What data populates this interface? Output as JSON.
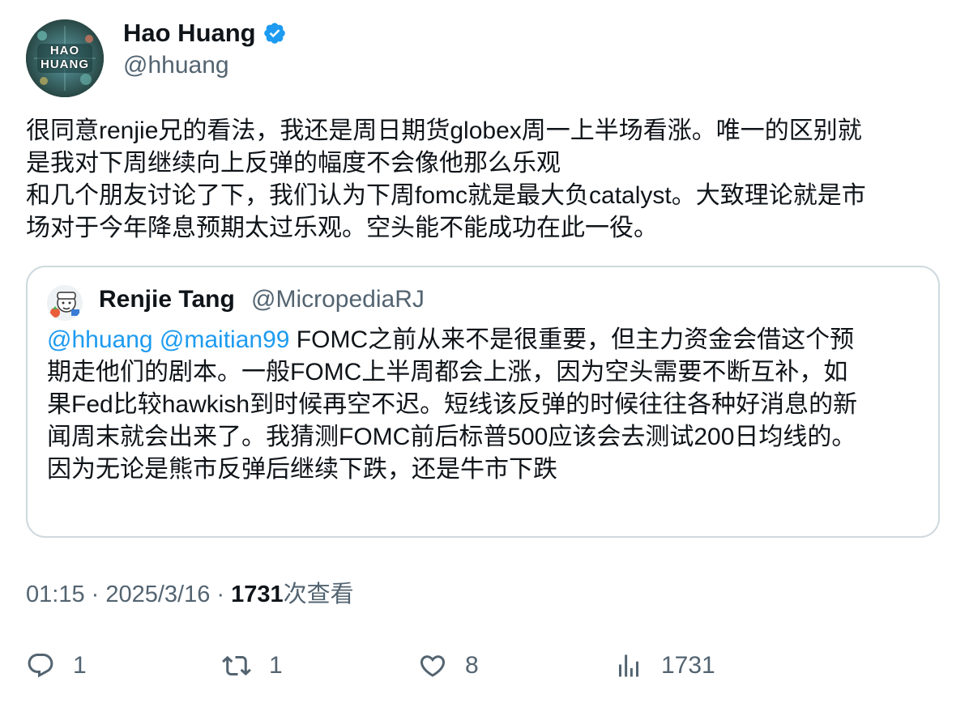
{
  "author": {
    "display_name": "Hao Huang",
    "handle": "@hhuang",
    "avatar_text": "HAO HUANG",
    "verified_color": "#1d9bf0"
  },
  "tweet": {
    "text": "很同意renjie兄的看法，我还是周日期货globex周一上半场看涨。唯一的区别就\n是我对下周继续向上反弹的幅度不会像他那么乐观\n和几个朋友讨论了下，我们认为下周fomc就是最大负catalyst。大致理论就是市\n场对于今年降息预期太过乐观。空头能不能成功在此一役。"
  },
  "quote": {
    "display_name": "Renjie Tang",
    "handle": "@MicropediaRJ",
    "mention1": "@hhuang",
    "mention2": "@maitian99",
    "text": " FOMC之前从来不是很重要，但主力资金会借这个预\n期走他们的剧本。一般FOMC上半周都会上涨，因为空头需要不断互补，如\n果Fed比较hawkish到时候再空不迟。短线该反弹的时候往往各种好消息的新\n闻周末就会出来了。我猜测FOMC前后标普500应该会去测试200日均线的。\n因为无论是熊市反弹后继续下跌，还是牛市下跌"
  },
  "meta": {
    "time": "01:15",
    "sep": " · ",
    "date": "2025/3/16",
    "views": "1731",
    "views_label": "次查看"
  },
  "actions": {
    "replies": "1",
    "retweets": "1",
    "likes": "8",
    "views": "1731"
  }
}
